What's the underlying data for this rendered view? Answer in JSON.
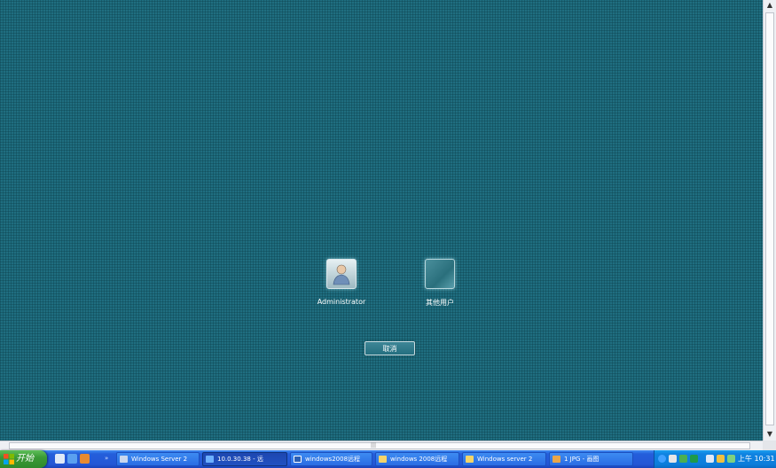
{
  "desktop": {
    "users": [
      {
        "name": "Administrator",
        "icon": "user-avatar-icon"
      },
      {
        "name": "其他用户",
        "icon": "other-user-icon"
      }
    ],
    "cancel_label": "取消"
  },
  "taskbar": {
    "start_label": "开始",
    "tasks": [
      {
        "label": "Windows Server 2",
        "icon": "window-icon",
        "active": false
      },
      {
        "label": "10.0.30.38 - 远",
        "icon": "remote-desktop-icon",
        "active": true
      },
      {
        "label": "windows2008远程",
        "icon": "word-doc-icon",
        "active": false
      },
      {
        "label": "windows 2008远程",
        "icon": "explorer-icon",
        "active": false
      },
      {
        "label": "Windows server 2",
        "icon": "explorer-icon",
        "active": false
      },
      {
        "label": "1 JPG - 画图",
        "icon": "paint-icon",
        "active": false
      }
    ],
    "clock": "上午 10:31"
  },
  "colors": {
    "desktop": "#1f6e80",
    "taskbar": "#245edb",
    "start": "#3a9a36",
    "tray": "#0c7ddb"
  }
}
